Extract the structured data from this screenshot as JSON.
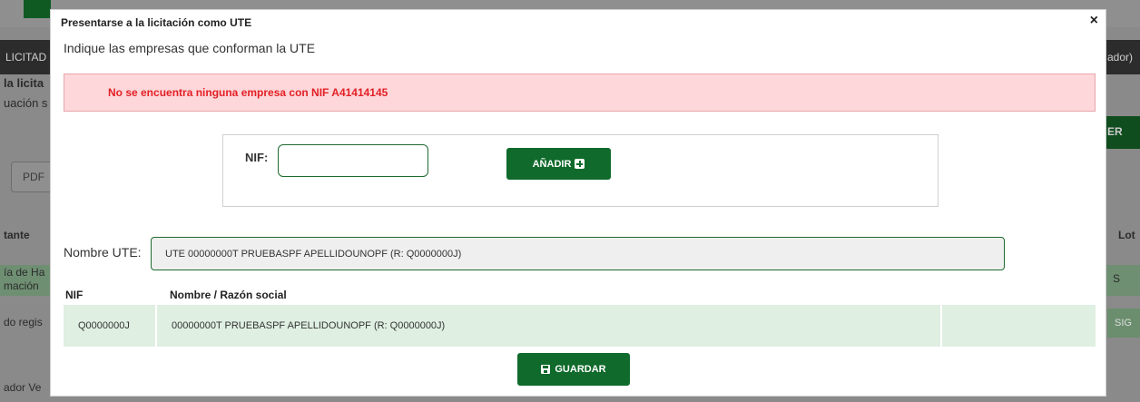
{
  "background": {
    "nav_left": "LICITAD",
    "nav_right": "ador)",
    "heading": "la licita",
    "subheading": "uación s",
    "pdf_label": "PDF",
    "col_left": "tante",
    "col_right": "Lot",
    "row1a": "ía de Ha",
    "row1b": "mación",
    "row1_right": "S",
    "row2": "do regis",
    "row2_right": "SIG",
    "footer": "ador Ve",
    "btn_right": "ER"
  },
  "modal": {
    "title": "Presentarse a la licitación como UTE",
    "close_glyph": "×",
    "subtitle": "Indique las empresas que conforman la UTE"
  },
  "alert": {
    "text": "No se encuentra ninguna empresa con NIF A41414145",
    "color": "#e31f26"
  },
  "nif_form": {
    "label": "NIF:",
    "value": "",
    "add_button": "AÑADIR",
    "add_icon": "plus-square-icon"
  },
  "ute": {
    "label": "Nombre UTE:",
    "value": "UTE 00000000T PRUEBASPF APELLIDOUNOPF (R: Q0000000J)"
  },
  "table": {
    "headers": [
      "NIF",
      "Nombre / Razón social"
    ],
    "rows": [
      {
        "nif": "Q0000000J",
        "name": "00000000T PRUEBASPF APELLIDOUNOPF (R: Q0000000J)"
      }
    ]
  },
  "save_button": {
    "label": "GUARDAR",
    "icon": "save-icon"
  },
  "colors": {
    "primary": "#0f6a2b",
    "row_bg": "#dfefe2",
    "alert_bg": "#fdd7d9"
  }
}
